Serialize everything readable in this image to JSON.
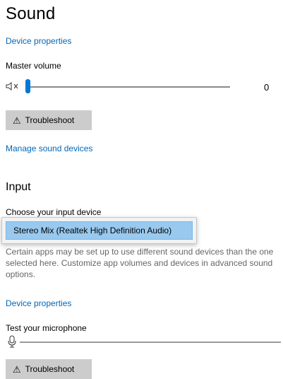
{
  "output": {
    "title": "Sound",
    "device_properties_link": "Device properties",
    "master_volume_label": "Master volume",
    "mute_icon": "speaker-muted-icon",
    "volume": 0,
    "volume_value": "0",
    "troubleshoot_label": "Troubleshoot",
    "manage_link": "Manage sound devices"
  },
  "input": {
    "heading": "Input",
    "choose_label": "Choose your input device",
    "selected_device": "Stereo Mix (Realtek High Definition Audio)",
    "description": "Certain apps may be set up to use different sound devices than the one selected here. Customize app volumes and devices in advanced sound options.",
    "device_properties_link": "Device properties",
    "test_label": "Test your microphone",
    "mic_icon": "microphone-icon",
    "mic_level": 0,
    "troubleshoot_label": "Troubleshoot"
  },
  "colors": {
    "accent": "#0078d7",
    "link": "#0067b8",
    "selection": "#99c9ef",
    "button": "#cccccc"
  }
}
